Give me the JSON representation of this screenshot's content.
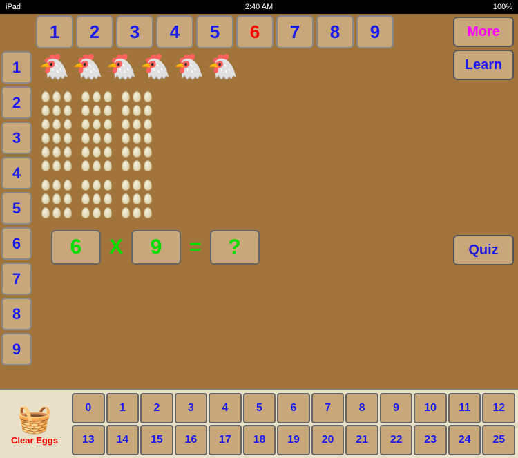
{
  "statusBar": {
    "device": "iPad",
    "time": "2:40 AM",
    "battery": "100%"
  },
  "topNumbers": [
    {
      "value": "1",
      "color": "blue"
    },
    {
      "value": "2",
      "color": "blue"
    },
    {
      "value": "3",
      "color": "blue"
    },
    {
      "value": "4",
      "color": "blue"
    },
    {
      "value": "5",
      "color": "blue"
    },
    {
      "value": "6",
      "color": "red"
    },
    {
      "value": "7",
      "color": "blue"
    },
    {
      "value": "8",
      "color": "blue"
    },
    {
      "value": "9",
      "color": "blue"
    }
  ],
  "leftNumbers": [
    "1",
    "2",
    "3",
    "4",
    "5",
    "6",
    "7",
    "8",
    "9"
  ],
  "chickens": [
    "🐔",
    "🐔",
    "🐔",
    "🐔",
    "🐔",
    "🐔"
  ],
  "buttons": {
    "more": "More",
    "learn": "Learn",
    "quiz": "Quiz"
  },
  "equation": {
    "num1": "6",
    "op": "X",
    "num2": "9",
    "eq": "=",
    "result": "?"
  },
  "bottomNumbers": {
    "row1": [
      "0",
      "1",
      "2",
      "3",
      "4",
      "5",
      "6",
      "7",
      "8",
      "9",
      "10",
      "11",
      "12"
    ],
    "row2": [
      "13",
      "14",
      "15",
      "16",
      "17",
      "18",
      "19",
      "20",
      "21",
      "22",
      "23",
      "24",
      "25"
    ]
  },
  "clearBtn": "Clear Eggs"
}
